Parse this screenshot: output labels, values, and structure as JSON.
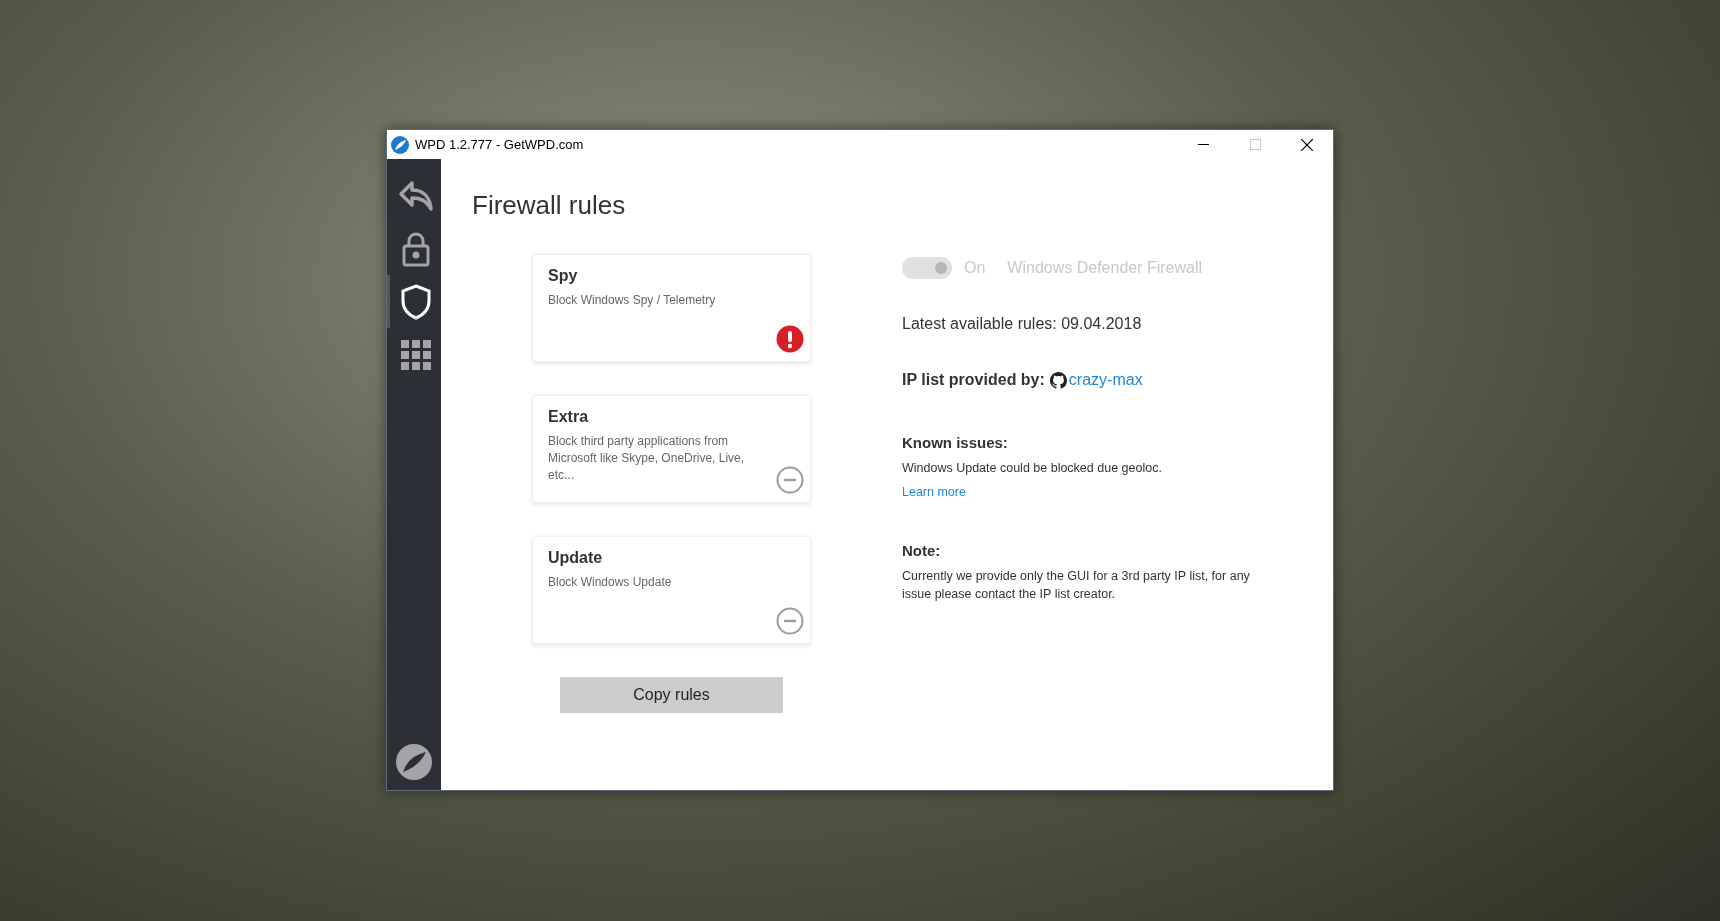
{
  "window": {
    "title": "WPD 1.2.777 - GetWPD.com"
  },
  "sidebar": {
    "items": [
      {
        "kind": "back",
        "selected": false
      },
      {
        "kind": "lock",
        "selected": false
      },
      {
        "kind": "shield",
        "selected": true
      },
      {
        "kind": "grid",
        "selected": false
      }
    ]
  },
  "heading": "Firewall rules",
  "rules": [
    {
      "title": "Spy",
      "description": "Block Windows Spy / Telemetry",
      "kind": "warning"
    },
    {
      "title": "Extra",
      "description": "Block third party applications from Microsoft like Skype, OneDrive, Live, etc...",
      "kind": "neutral"
    },
    {
      "title": "Update",
      "description": "Block Windows Update",
      "kind": "neutral"
    }
  ],
  "copy_button": "Copy rules",
  "firewall_toggle": {
    "on": true,
    "disabled": true,
    "state_label": "On",
    "label": "Windows Defender Firewall"
  },
  "latest_rules": "Latest available rules: 09.04.2018",
  "ip_list": {
    "label": "IP list provided by:",
    "link": "crazy-max"
  },
  "known_issues": {
    "title": "Known issues:",
    "text": "Windows Update could be blocked due geoloc.",
    "link": "Learn more"
  },
  "note": {
    "title": "Note:",
    "text": "Currently we provide only the GUI for a 3rd party IP list, for any issue please contact the IP list creator."
  }
}
